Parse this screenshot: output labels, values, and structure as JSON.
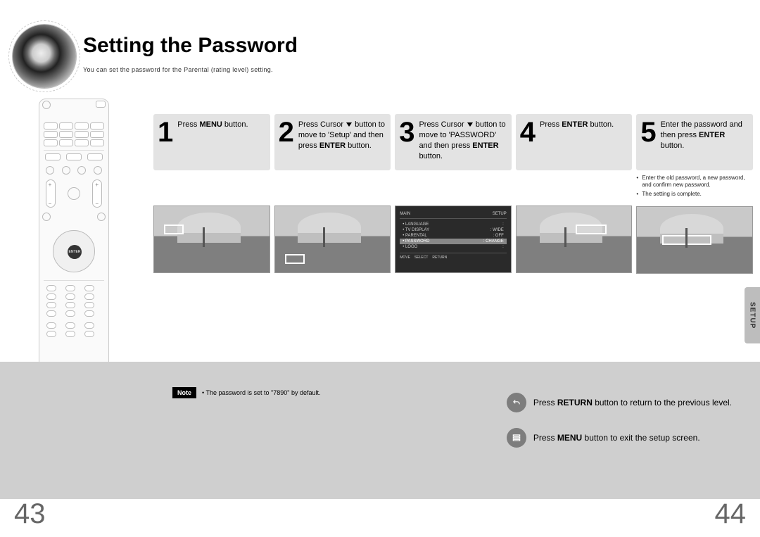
{
  "title": "Setting the Password",
  "subtitle": "You can set the password for the Parental (rating level) setting.",
  "remote": {
    "enter_label": "ENTER"
  },
  "steps": [
    {
      "num": "1",
      "html": "Press <b>MENU</b> button."
    },
    {
      "num": "2",
      "html": "Press Cursor <span class='cursor-down'></span> button to move to 'Setup' and then press <b>ENTER</b> button."
    },
    {
      "num": "3",
      "html": "Press Cursor <span class='cursor-down'></span> button to move to 'PASSWORD' and then press <b>ENTER</b> button."
    },
    {
      "num": "4",
      "html": "Press <b>ENTER</b> button."
    },
    {
      "num": "5",
      "html": "Enter the password and then press <b>ENTER</b> button."
    }
  ],
  "step5_notes": [
    "Enter the old password, a new password, and confirm new password.",
    "The setting is complete."
  ],
  "menu_thumb": {
    "top_left": "MAIN",
    "top_right": "SETUP",
    "rows": [
      {
        "label": "LANGUAGE",
        "value": ""
      },
      {
        "label": "TV DISPLAY",
        "value": "WIDE"
      },
      {
        "label": "PARENTAL",
        "value": "OFF"
      },
      {
        "label": "PASSWORD",
        "value": "CHANGE",
        "hl": true
      },
      {
        "label": "LOGO",
        "value": ""
      }
    ],
    "bottom": [
      "MOVE",
      "SELECT",
      "RETURN"
    ]
  },
  "note": {
    "badge": "Note",
    "text": "• The password is set to \"7890\" by default."
  },
  "info": {
    "return": "Press <b>RETURN</b> button to return to the previous level.",
    "menu": "Press <b>MENU</b> button to exit the setup screen."
  },
  "side_tab": "SETUP",
  "page_left": "43",
  "page_right": "44"
}
